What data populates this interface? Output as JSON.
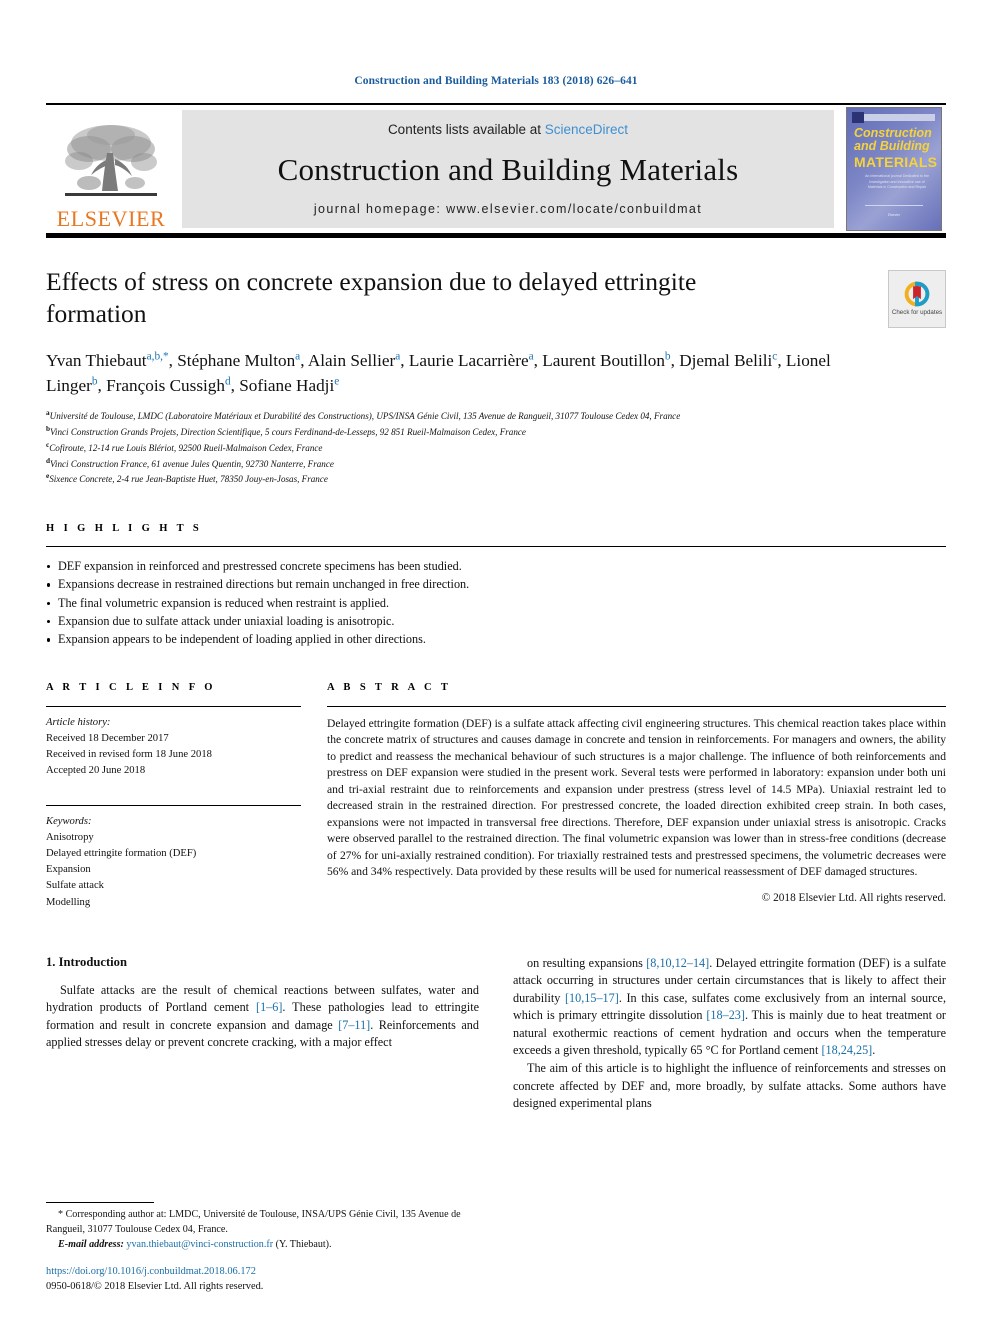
{
  "running_head": "Construction and Building Materials 183 (2018) 626–641",
  "masthead": {
    "publisher": "ELSEVIER",
    "contents_prefix": "Contents lists available at ",
    "contents_link": "ScienceDirect",
    "journal_title": "Construction and Building Materials",
    "homepage": "journal homepage: www.elsevier.com/locate/conbuildmat",
    "cover": {
      "line1": "Construction",
      "line2": "and Building",
      "line3": "MATERIALS",
      "subtitle": "An international journal Dedicated to the Investigation and Innovative use of Materials in Construction and Repair",
      "footer": "Elsevier"
    }
  },
  "article": {
    "title": "Effects of stress on concrete expansion due to delayed ettringite formation",
    "crossmark_label": "Check for updates",
    "authors_html": "Yvan Thiebaut<sup>a,b,*</sup>, Stéphane Multon<sup>a</sup>, Alain Sellier<sup>a</sup>, Laurie Lacarrière<sup>a</sup>, Laurent Boutillon<sup>b</sup>, Djemal Belili<sup>c</sup>, Lionel Linger<sup>b</sup>, François Cussigh<sup>d</sup>, Sofiane Hadji<sup>e</sup>",
    "affiliations": [
      {
        "mark": "a",
        "text": "Université de Toulouse, LMDC (Laboratoire Matériaux et Durabilité des Constructions), UPS/INSA Génie Civil, 135 Avenue de Rangueil, 31077 Toulouse Cedex 04, France"
      },
      {
        "mark": "b",
        "text": "Vinci Construction Grands Projets, Direction Scientifique, 5 cours Ferdinand-de-Lesseps, 92 851 Rueil-Malmaison Cedex, France"
      },
      {
        "mark": "c",
        "text": "Cofiroute, 12-14 rue Louis Blériot, 92500 Rueil-Malmaison Cedex, France"
      },
      {
        "mark": "d",
        "text": "Vinci Construction France, 61 avenue Jules Quentin, 92730 Nanterre, France"
      },
      {
        "mark": "e",
        "text": "Sixence Concrete, 2-4 rue Jean-Baptiste Huet, 78350 Jouy-en-Josas, France"
      }
    ]
  },
  "highlights": {
    "heading": "H I G H L I G H T S",
    "items": [
      "DEF expansion in reinforced and prestressed concrete specimens has been studied.",
      "Expansions decrease in restrained directions but remain unchanged in free direction.",
      "The final volumetric expansion is reduced when restraint is applied.",
      "Expansion due to sulfate attack under uniaxial loading is anisotropic.",
      "Expansion appears to be independent of loading applied in other directions."
    ]
  },
  "article_info": {
    "heading": "A R T I C L E  I N F O",
    "history_label": "Article history:",
    "history": [
      "Received 18 December 2017",
      "Received in revised form 18 June 2018",
      "Accepted 20 June 2018"
    ],
    "keywords_label": "Keywords:",
    "keywords": [
      "Anisotropy",
      "Delayed ettringite formation (DEF)",
      "Expansion",
      "Sulfate attack",
      "Modelling"
    ]
  },
  "abstract": {
    "heading": "A B S T R A C T",
    "text": "Delayed ettringite formation (DEF) is a sulfate attack affecting civil engineering structures. This chemical reaction takes place within the concrete matrix of structures and causes damage in concrete and tension in reinforcements. For managers and owners, the ability to predict and reassess the mechanical behaviour of such structures is a major challenge. The influence of both reinforcements and prestress on DEF expansion were studied in the present work. Several tests were performed in laboratory: expansion under both uni and tri-axial restraint due to reinforcements and expansion under prestress (stress level of 14.5 MPa). Uniaxial restraint led to decreased strain in the restrained direction. For prestressed concrete, the loaded direction exhibited creep strain. In both cases, expansions were not impacted in transversal free directions. Therefore, DEF expansion under uniaxial stress is anisotropic. Cracks were observed parallel to the restrained direction. The final volumetric expansion was lower than in stress-free conditions (decrease of 27% for uni-axially restrained condition). For triaxially restrained tests and prestressed specimens, the volumetric decreases were 56% and 34% respectively. Data provided by these results will be used for numerical reassessment of DEF damaged structures.",
    "copyright": "© 2018 Elsevier Ltd. All rights reserved."
  },
  "body": {
    "section_title": "1. Introduction",
    "left_paragraph_html": "Sulfate attacks are the result of chemical reactions between sulfates, water and hydration products of Portland cement <span class=\"ref\">[1–6]</span>. These pathologies lead to ettringite formation and result in concrete expansion and damage <span class=\"ref\">[7–11]</span>. Reinforcements and applied stresses delay or prevent concrete cracking, with a major effect",
    "right_paragraph1_html": "on resulting expansions <span class=\"ref\">[8,10,12–14]</span>. Delayed ettringite formation (DEF) is a sulfate attack occurring in structures under certain circumstances that is likely to affect their durability <span class=\"ref\">[10,15–17]</span>. In this case, sulfates come exclusively from an internal source, which is primary ettringite dissolution <span class=\"ref\">[18–23]</span>. This is mainly due to heat treatment or natural exothermic reactions of cement hydration and occurs when the temperature exceeds a given threshold, typically 65 °C for Portland cement <span class=\"ref\">[18,24,25]</span>.",
    "right_paragraph2_html": "The aim of this article is to highlight the influence of reinforcements and stresses on concrete affected by DEF and, more broadly, by sulfate attacks. Some authors have designed experimental plans"
  },
  "footer": {
    "corresponding_html": "<span class=\"indent\">* Corresponding author at: LMDC, Université de Toulouse, INSA/UPS Génie Civil, 135 Avenue de Rangueil, 31077 Toulouse Cedex 04, France.</span>",
    "email_label": "E-mail address:",
    "email": "yvan.thiebaut@vinci-construction.fr",
    "email_suffix": "(Y. Thiebaut).",
    "doi": "https://doi.org/10.1016/j.conbuildmat.2018.06.172",
    "issn": "0950-0618/© 2018 Elsevier Ltd. All rights reserved."
  },
  "colors": {
    "link_blue": "#1a6fa8",
    "sciencedirect_blue": "#3f8fd0",
    "elsevier_orange": "#E87722",
    "superscript_blue": "#1f77b4"
  }
}
